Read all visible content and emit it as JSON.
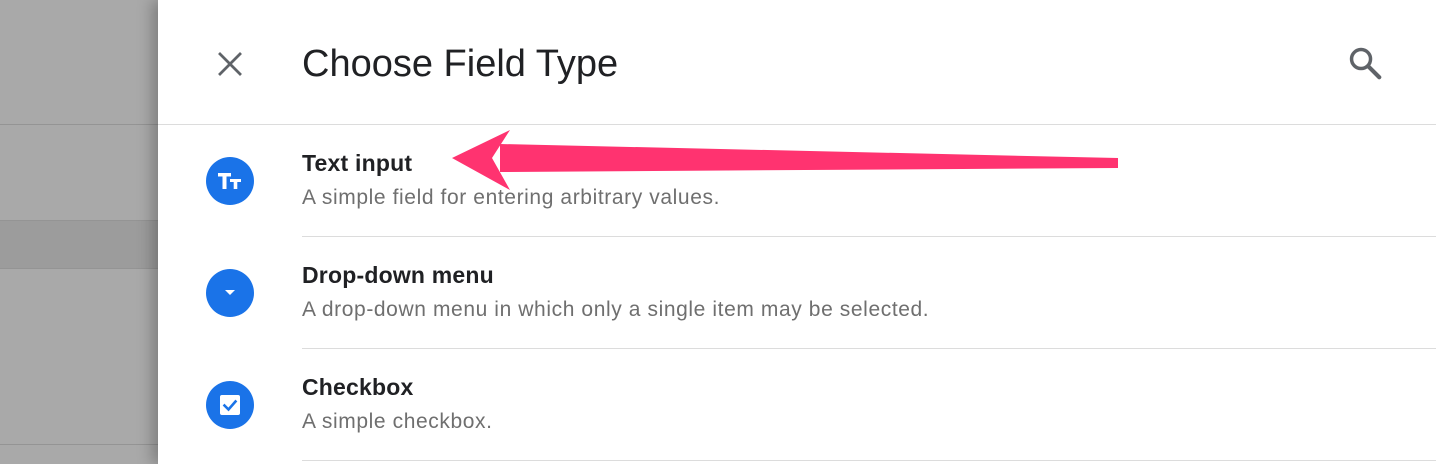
{
  "dialog": {
    "title": "Choose Field Type",
    "close_icon": "close-icon",
    "search_icon": "search-icon"
  },
  "field_types": [
    {
      "name": "Text input",
      "description": "A simple field for entering arbitrary values.",
      "icon": "text-format-icon"
    },
    {
      "name": "Drop-down menu",
      "description": "A drop-down menu in which only a single item may be selected.",
      "icon": "dropdown-icon"
    },
    {
      "name": "Checkbox",
      "description": "A simple checkbox.",
      "icon": "checkbox-icon"
    }
  ],
  "colors": {
    "icon_background": "#1a73e8",
    "annotation_arrow": "#ff3370",
    "title_text": "#202124",
    "description_text": "#6f6f6f"
  }
}
